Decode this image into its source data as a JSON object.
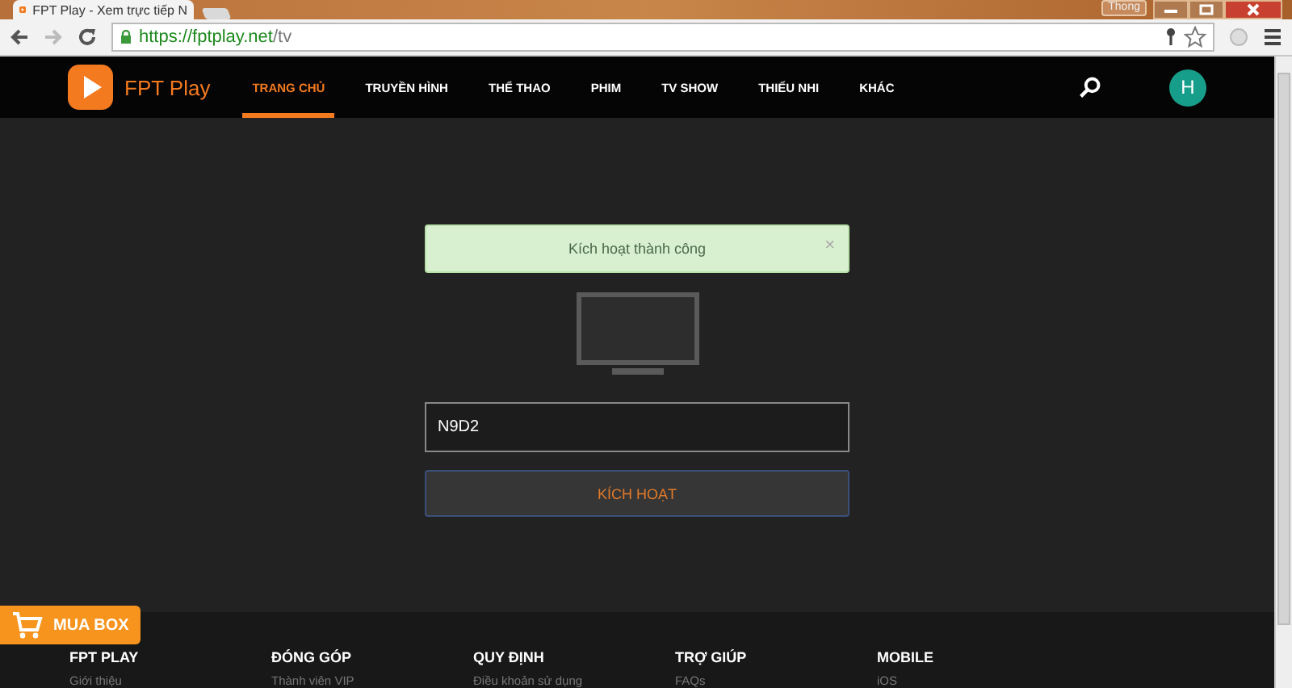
{
  "browser": {
    "tab_title": "FPT Play - Xem trực tiếp N",
    "user_button": "Thong",
    "url_host": "https://fptplay.net",
    "url_path": "/tv"
  },
  "nav": {
    "brand": "FPT Play",
    "avatar": "H",
    "items": [
      {
        "label": "TRANG CHỦ",
        "selected": true
      },
      {
        "label": "TRUYỀN HÌNH",
        "selected": false
      },
      {
        "label": "THỂ THAO",
        "selected": false
      },
      {
        "label": "PHIM",
        "selected": false
      },
      {
        "label": "TV SHOW",
        "selected": false
      },
      {
        "label": "THIẾU NHI",
        "selected": false
      },
      {
        "label": "KHÁC",
        "selected": false
      }
    ]
  },
  "alert": {
    "message": "Kích hoạt thành công",
    "close": "×"
  },
  "code_field": {
    "value": "N9D2"
  },
  "activate_button": "KÍCH HOẠT",
  "buy_box_button": "MUA BOX",
  "footer": {
    "columns": [
      {
        "heading": "FPT PLAY",
        "link": "Giới thiệu"
      },
      {
        "heading": "ĐÓNG GÓP",
        "link": "Thành viên VIP"
      },
      {
        "heading": "QUY ĐỊNH",
        "link": "Điều khoản sử dụng"
      },
      {
        "heading": "TRỢ GIÚP",
        "link": "FAQs"
      },
      {
        "heading": "MOBILE",
        "link": "iOS"
      }
    ]
  }
}
